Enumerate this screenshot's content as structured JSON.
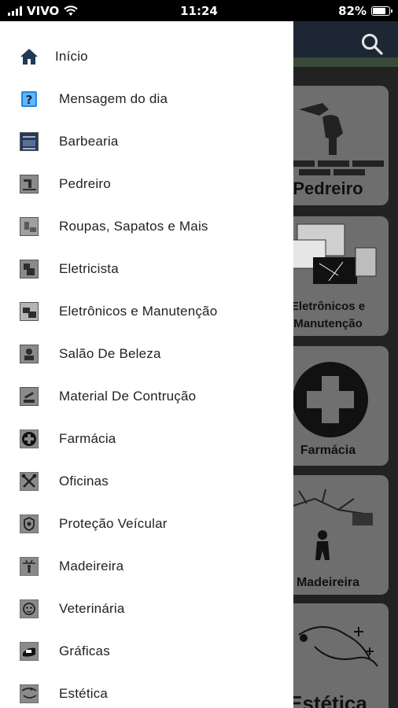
{
  "status": {
    "carrier": "VIVO",
    "time": "11:24",
    "battery": "82%",
    "battery_level": 0.82
  },
  "header": {
    "search_icon": "search-icon"
  },
  "cards": [
    {
      "label": "Pedreiro"
    },
    {
      "label": "Eletrônicos e Manutenção"
    },
    {
      "label": "Farmácia"
    },
    {
      "label": "Madeireira"
    },
    {
      "label": "Estética"
    }
  ],
  "menu": [
    {
      "label": "Início",
      "icon": "home-icon"
    },
    {
      "label": "Mensagem do dia",
      "icon": "question-icon"
    },
    {
      "label": "Barbearia",
      "icon": "barbearia-thumb-icon"
    },
    {
      "label": "Pedreiro",
      "icon": "pedreiro-thumb-icon"
    },
    {
      "label": "Roupas, Sapatos e Mais",
      "icon": "roupas-thumb-icon"
    },
    {
      "label": "Eletricista",
      "icon": "eletricista-thumb-icon"
    },
    {
      "label": "Eletrônicos e Manutenção",
      "icon": "eletronicos-thumb-icon"
    },
    {
      "label": "Salão De Beleza",
      "icon": "salao-thumb-icon"
    },
    {
      "label": "Material De Contrução",
      "icon": "material-thumb-icon"
    },
    {
      "label": "Farmácia",
      "icon": "farmacia-thumb-icon"
    },
    {
      "label": "Oficinas",
      "icon": "oficinas-thumb-icon"
    },
    {
      "label": "Proteção Veícular",
      "icon": "protecao-thumb-icon"
    },
    {
      "label": "Madeireira",
      "icon": "madeireira-thumb-icon"
    },
    {
      "label": "Veterinária",
      "icon": "veterinaria-thumb-icon"
    },
    {
      "label": "Gráficas",
      "icon": "graficas-thumb-icon"
    },
    {
      "label": "Estética",
      "icon": "estetica-thumb-icon"
    }
  ],
  "colors": {
    "drawer_bg": "#ffffff",
    "header_bg": "#1c2733",
    "card_bg": "#6e6e6e",
    "home_icon": "#1f3a52",
    "question_icon": "#1e88e5"
  }
}
